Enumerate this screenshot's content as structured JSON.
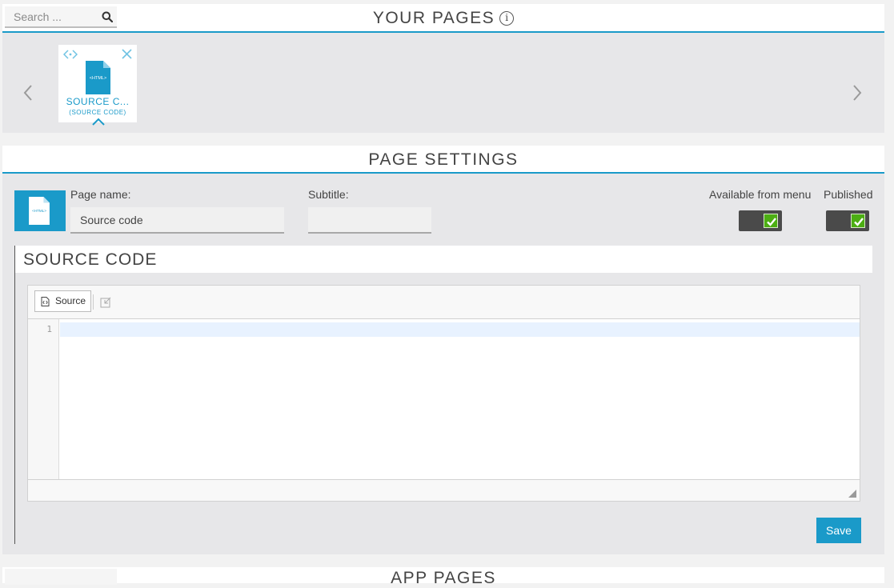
{
  "search": {
    "placeholder": "Search ..."
  },
  "your_pages": {
    "title": "YOUR PAGES",
    "info_glyph": "i",
    "cards": [
      {
        "name": "SOURCE C...",
        "type_label": "(SOURCE CODE)",
        "file_badge": "<HTML>",
        "selected": true
      }
    ]
  },
  "page_settings": {
    "title": "PAGE SETTINGS",
    "tile_badge": "<HTML>",
    "page_name_label": "Page name:",
    "page_name_value": "Source code",
    "subtitle_label": "Subtitle:",
    "subtitle_value": "",
    "available_label": "Available from menu",
    "available_on": true,
    "published_label": "Published",
    "published_on": true
  },
  "source_code": {
    "title": "SOURCE CODE",
    "source_button_label": "Source",
    "line_numbers": [
      "1"
    ],
    "save_label": "Save"
  },
  "next_section": {
    "title": "APP PAGES"
  },
  "colors": {
    "accent": "#1a9ac9",
    "toggle_on": "#4cae13",
    "panel_bg": "#e7e7e9"
  }
}
